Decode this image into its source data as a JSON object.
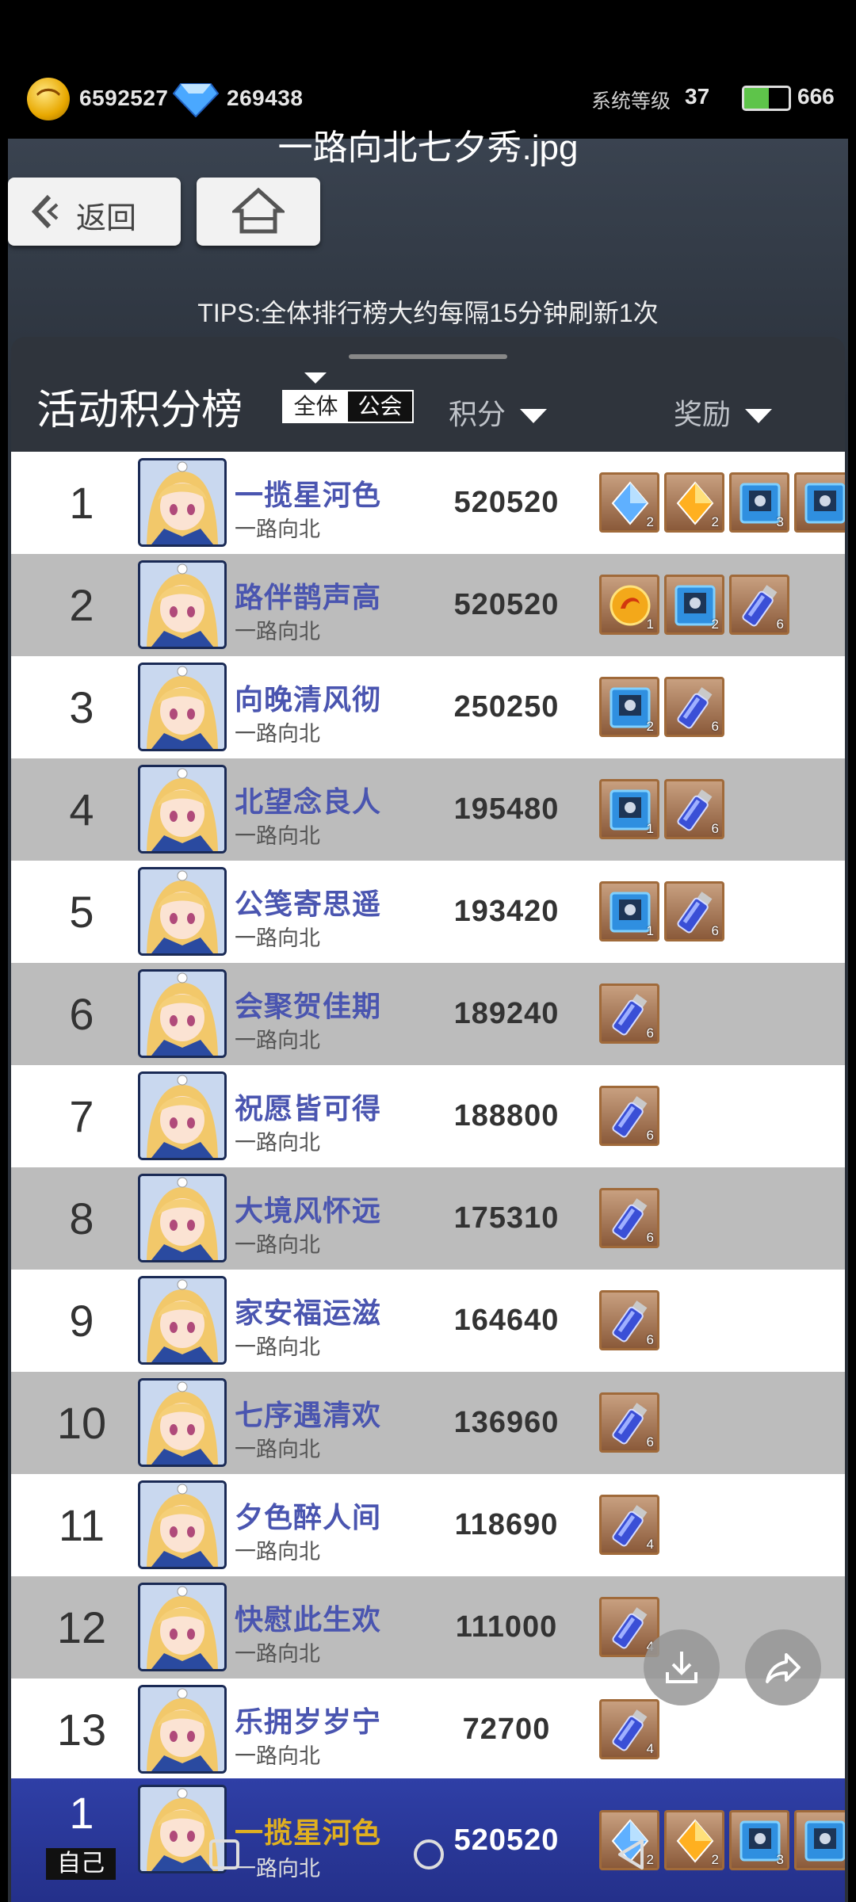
{
  "hud": {
    "coins": "6592527",
    "gems": "269438",
    "level_label": "系统等级",
    "level": "37",
    "energy": "666",
    "energy_fill": 0.55
  },
  "viewer_title": "一路向北七夕秀.jpg",
  "nav": {
    "back_label": "返回"
  },
  "tips": "TIPS:全体排行榜大约每隔15分钟刷新1次",
  "board": {
    "title": "活动积分榜",
    "scope_tabs": [
      "全体",
      "公会"
    ],
    "col_score": "积分",
    "col_reward": "奖励"
  },
  "rows": [
    {
      "rank": "1",
      "name": "一揽星河色",
      "guild": "一路向北",
      "score": "520520",
      "rewards": [
        {
          "type": "blue-crystal",
          "count": "2"
        },
        {
          "type": "gold-crystal",
          "count": "2"
        },
        {
          "type": "blue-card",
          "count": "3"
        },
        {
          "type": "blue-card",
          "count": ""
        }
      ]
    },
    {
      "rank": "2",
      "name": "路伴鹊声高",
      "guild": "一路向北",
      "score": "520520",
      "rewards": [
        {
          "type": "gold-coin",
          "count": "1"
        },
        {
          "type": "blue-card",
          "count": "2"
        },
        {
          "type": "vial",
          "count": "6"
        }
      ]
    },
    {
      "rank": "3",
      "name": "向晚清风彻",
      "guild": "一路向北",
      "score": "250250",
      "rewards": [
        {
          "type": "blue-card",
          "count": "2"
        },
        {
          "type": "vial",
          "count": "6"
        }
      ]
    },
    {
      "rank": "4",
      "name": "北望念良人",
      "guild": "一路向北",
      "score": "195480",
      "rewards": [
        {
          "type": "blue-card",
          "count": "1"
        },
        {
          "type": "vial",
          "count": "6"
        }
      ]
    },
    {
      "rank": "5",
      "name": "公笺寄思遥",
      "guild": "一路向北",
      "score": "193420",
      "rewards": [
        {
          "type": "blue-card",
          "count": "1"
        },
        {
          "type": "vial",
          "count": "6"
        }
      ]
    },
    {
      "rank": "6",
      "name": "会聚贺佳期",
      "guild": "一路向北",
      "score": "189240",
      "rewards": [
        {
          "type": "vial",
          "count": "6"
        }
      ]
    },
    {
      "rank": "7",
      "name": "祝愿皆可得",
      "guild": "一路向北",
      "score": "188800",
      "rewards": [
        {
          "type": "vial",
          "count": "6"
        }
      ]
    },
    {
      "rank": "8",
      "name": "大境风怀远",
      "guild": "一路向北",
      "score": "175310",
      "rewards": [
        {
          "type": "vial",
          "count": "6"
        }
      ]
    },
    {
      "rank": "9",
      "name": "家安福运滋",
      "guild": "一路向北",
      "score": "164640",
      "rewards": [
        {
          "type": "vial",
          "count": "6"
        }
      ]
    },
    {
      "rank": "10",
      "name": "七序遇清欢",
      "guild": "一路向北",
      "score": "136960",
      "rewards": [
        {
          "type": "vial",
          "count": "6"
        }
      ]
    },
    {
      "rank": "11",
      "name": "夕色醉人间",
      "guild": "一路向北",
      "score": "118690",
      "rewards": [
        {
          "type": "vial",
          "count": "4"
        }
      ]
    },
    {
      "rank": "12",
      "name": "快慰此生欢",
      "guild": "一路向北",
      "score": "111000",
      "rewards": [
        {
          "type": "vial",
          "count": "4"
        }
      ]
    },
    {
      "rank": "13",
      "name": "乐拥岁岁宁",
      "guild": "一路向北",
      "score": "72700",
      "rewards": [
        {
          "type": "vial",
          "count": "4"
        }
      ]
    }
  ],
  "self_row": {
    "rank": "1",
    "tag": "自己",
    "name": "一揽星河色",
    "guild": "一路向北",
    "score": "520520",
    "rewards": [
      {
        "type": "blue-crystal",
        "count": "2"
      },
      {
        "type": "gold-crystal",
        "count": "2"
      },
      {
        "type": "blue-card",
        "count": "3"
      },
      {
        "type": "blue-card",
        "count": ""
      }
    ]
  },
  "colors": {
    "name": "#4a55b0",
    "self_bg": "#2f3fa6",
    "row_alt": "#bcbcbc"
  }
}
